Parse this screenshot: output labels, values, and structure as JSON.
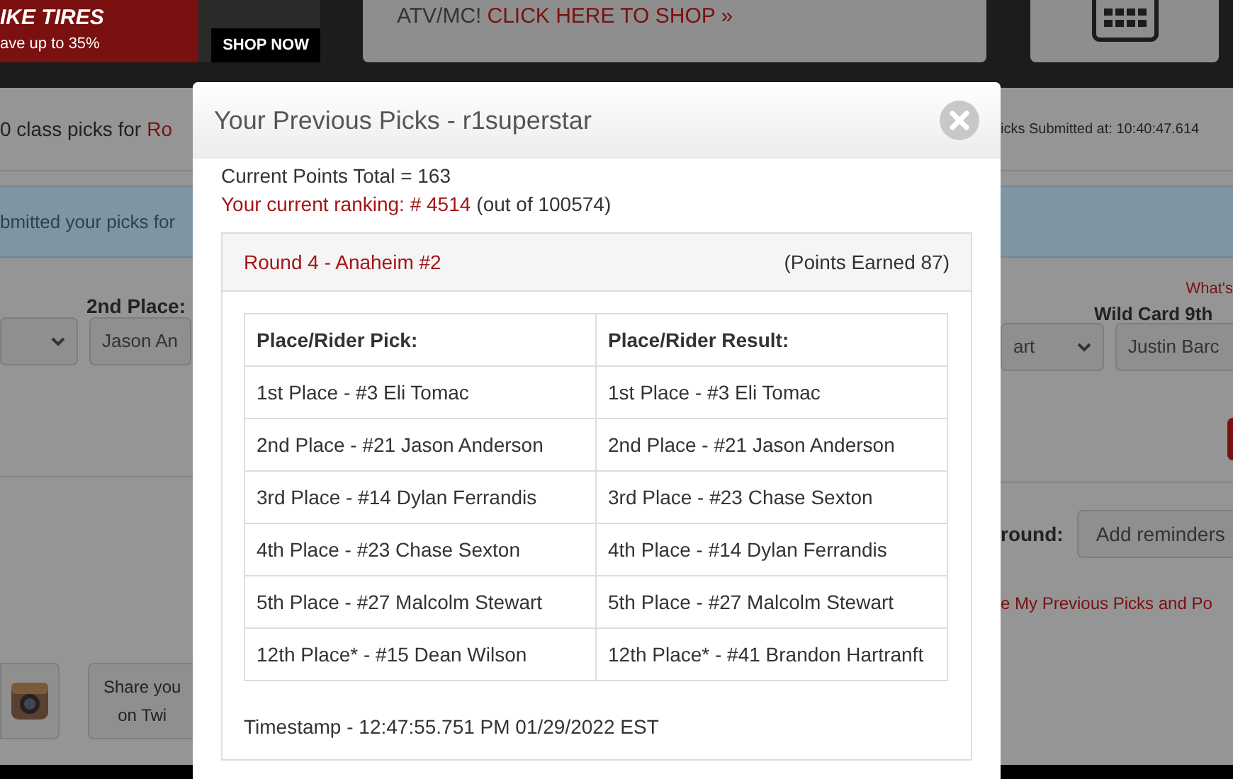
{
  "top_bar": {
    "banner": {
      "headline": "IKE TIRES",
      "offer": "ave up to 35%",
      "cta": "SHOP NOW"
    },
    "promo": {
      "text": "ATV/MC!",
      "link": "CLICK HERE TO SHOP »"
    }
  },
  "page": {
    "heading": "0 class picks for",
    "heading_link": "Ro",
    "submitted": "icks Submitted at: 10:40:47.614",
    "alert": "bmitted your picks for",
    "left_label": "2nd Place:",
    "help_link": "What's",
    "right_label": "Wild Card 9th",
    "selects": [
      {
        "value": "Jason An"
      },
      {
        "value": "art",
        "chevron": true
      },
      {
        "value": "Justin Barc"
      }
    ],
    "reminder_label": "round:",
    "reminder_placeholder": "Add reminders",
    "previous_link": "e My Previous Picks and Po",
    "share": "Share you\non Twi"
  },
  "modal": {
    "title": "Your Previous Picks - r1superstar",
    "points_total": "Current Points Total = 163",
    "ranking": "Your current ranking: # 4514",
    "ranking_note": "(out of 100574)",
    "round": {
      "title": "Round 4 - Anaheim #2",
      "points": "(Points Earned 87)",
      "columns": [
        "Place/Rider Pick:",
        "Place/Rider Result:"
      ],
      "rows": [
        [
          "1st Place - #3 Eli Tomac",
          "1st Place - #3 Eli Tomac"
        ],
        [
          "2nd Place - #21 Jason Anderson",
          "2nd Place - #21 Jason Anderson"
        ],
        [
          "3rd Place - #14 Dylan Ferrandis",
          "3rd Place - #23 Chase Sexton"
        ],
        [
          "4th Place - #23 Chase Sexton",
          "4th Place - #14 Dylan Ferrandis"
        ],
        [
          "5th Place - #27 Malcolm Stewart",
          "5th Place - #27 Malcolm Stewart"
        ],
        [
          "12th Place* - #15 Dean Wilson",
          "12th Place* - #41 Brandon Hartranft"
        ]
      ],
      "timestamp": "Timestamp - 12:47:55.751 PM 01/29/2022 EST"
    }
  }
}
